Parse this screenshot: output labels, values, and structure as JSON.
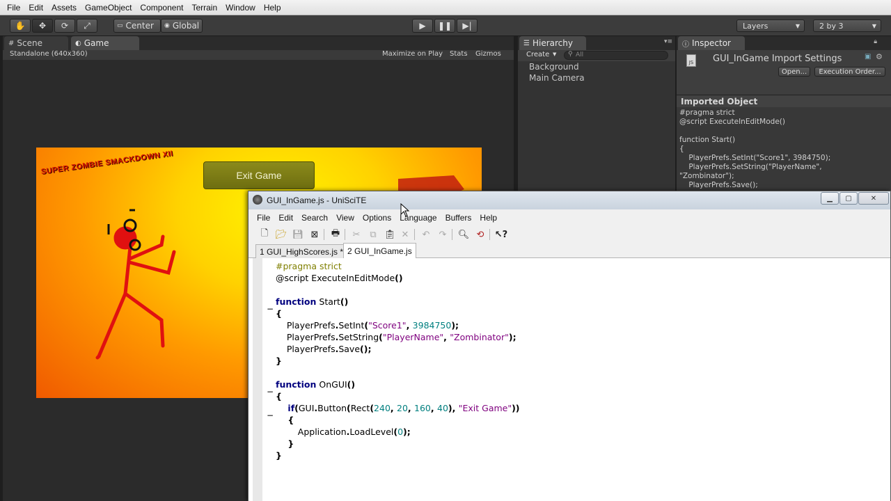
{
  "unity": {
    "menu": [
      "File",
      "Edit",
      "Assets",
      "GameObject",
      "Component",
      "Terrain",
      "Window",
      "Help"
    ],
    "toolbar": {
      "pivot_label": "Center",
      "space_label": "Global",
      "layers_label": "Layers",
      "layout_label": "2 by 3"
    },
    "scene_tab": "Scene",
    "game_tab": "Game",
    "game_toolbar": {
      "resolution": "Standalone (640x360)",
      "maximize": "Maximize on Play",
      "stats": "Stats",
      "gizmos": "Gizmos"
    },
    "game_canvas": {
      "logo_text": "SUPER ZOMBIE SMACKDOWN XII",
      "exit_button": "Exit Game"
    },
    "hierarchy": {
      "tab": "Hierarchy",
      "create_label": "Create",
      "search_placeholder": "All",
      "items": [
        "Background",
        "Main Camera"
      ]
    },
    "inspector": {
      "tab": "Inspector",
      "title": "GUI_InGame Import Settings",
      "open_label": "Open...",
      "exec_order_label": "Execution Order...",
      "section_label": "Imported Object",
      "preview_lines": [
        "#pragma strict",
        "@script ExecuteInEditMode()",
        "",
        "function Start()",
        "{",
        "    PlayerPrefs.SetInt(\"Score1\", 3984750);",
        "    PlayerPrefs.SetString(\"PlayerName\",",
        "\"Zombinator\");",
        "    PlayerPrefs.Save();"
      ]
    }
  },
  "scite": {
    "title": "GUI_InGame.js - UniSciTE",
    "menu": [
      "File",
      "Edit",
      "Search",
      "View",
      "Options",
      "Language",
      "Buffers",
      "Help"
    ],
    "tabs": [
      "1 GUI_HighScores.js *",
      "2 GUI_InGame.js"
    ],
    "code": {
      "l1": "#pragma strict",
      "l2a": "@script ExecuteInEditMode",
      "l2b": "()",
      "l4a": "function",
      "l4b": " Start",
      "l4c": "()",
      "l5": "{",
      "l6a": "    PlayerPrefs",
      "l6b": ".",
      "l6c": "SetInt",
      "l6d": "(",
      "l6e": "\"Score1\"",
      "l6f": ", ",
      "l6g": "3984750",
      "l6h": ");",
      "l7a": "    PlayerPrefs",
      "l7b": ".",
      "l7c": "SetString",
      "l7d": "(",
      "l7e": "\"PlayerName\"",
      "l7f": ", ",
      "l7g": "\"Zombinator\"",
      "l7h": ");",
      "l8a": "    PlayerPrefs",
      "l8b": ".",
      "l8c": "Save",
      "l8d": "();",
      "l9": "}",
      "l11a": "function",
      "l11b": " OnGUI",
      "l11c": "()",
      "l12": "{",
      "l13a": "    if",
      "l13b": "(",
      "l13c": "GUI",
      "l13d": ".",
      "l13e": "Button",
      "l13f": "(",
      "l13g": "Rect",
      "l13h": "(",
      "l13i": "240",
      "l13j": ", ",
      "l13k": "20",
      "l13l": ", ",
      "l13m": "160",
      "l13n": ", ",
      "l13o": "40",
      "l13p": "), ",
      "l13q": "\"Exit Game\"",
      "l13r": "))",
      "l14": "    {",
      "l15a": "        Application",
      "l15b": ".",
      "l15c": "LoadLevel",
      "l15d": "(",
      "l15e": "0",
      "l15f": ");",
      "l16": "    }",
      "l17": "}"
    }
  },
  "colors": {
    "unity_dark": "#3c3c3c",
    "game_bg_center": "#fff500",
    "game_bg_edge": "#f05a00",
    "exit_button": "#7d7c16",
    "keyword": "#00007f",
    "string": "#7f007f",
    "number": "#007f7f",
    "preprocessor": "#7f7f00"
  },
  "icons": {
    "hand": "hand-tool-icon",
    "move": "move-tool-icon",
    "rotate": "rotate-tool-icon",
    "scale": "scale-tool-icon",
    "play": "play-icon",
    "pause": "pause-icon",
    "step": "step-icon"
  }
}
